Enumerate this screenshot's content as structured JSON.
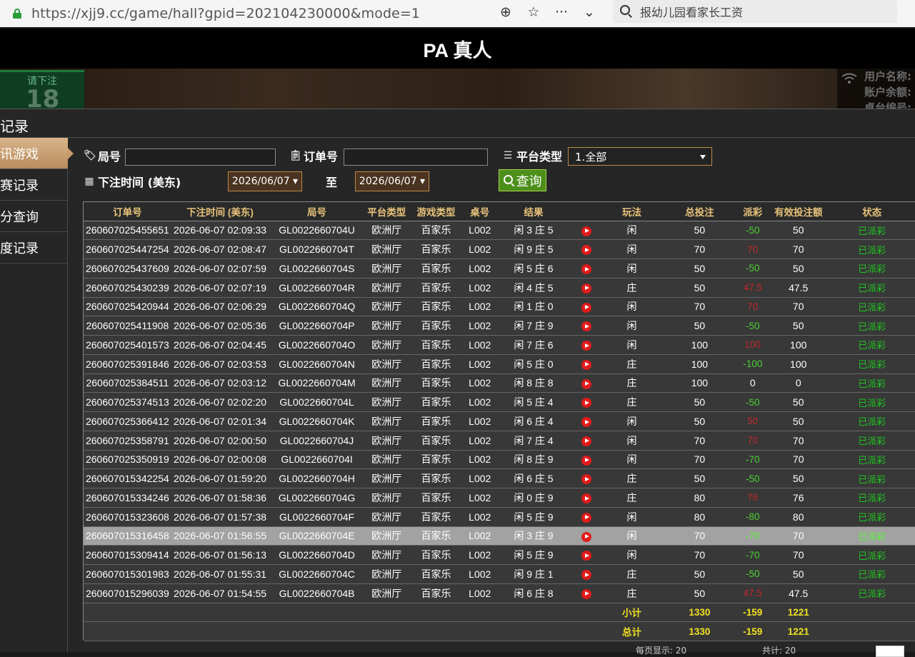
{
  "browser": {
    "url": "https://xjj9.cc/game/hall?gpid=202104230000&mode=1",
    "search_text": "报幼儿园看家长工资",
    "icons": [
      "add-circle-icon",
      "star-icon",
      "more-icon",
      "chevron-down-icon"
    ]
  },
  "header": {
    "title": "PA 真人"
  },
  "scene": {
    "bet_label": "请下注",
    "bet_countdown": "18",
    "user_lines": [
      "用户名称:",
      "账户余额:",
      "桌台编号:"
    ]
  },
  "panel": {
    "title": "记录"
  },
  "sidebar": {
    "items": [
      {
        "label": "讯游戏",
        "active": true
      },
      {
        "label": "赛记录",
        "active": false
      },
      {
        "label": "分查询",
        "active": false
      },
      {
        "label": "度记录",
        "active": false
      }
    ]
  },
  "filters": {
    "round_label": "局号",
    "order_label": "订单号",
    "platform_label": "平台类型",
    "platform_value": "1.全部",
    "time_label": "下注时间 (美东)",
    "date_from": "2026/06/07 ▾",
    "to_label": "至",
    "date_to": "2026/06/07 ▾",
    "query_label": "查询"
  },
  "table": {
    "headers": [
      "订单号",
      "下注时间 (美东)",
      "局号",
      "平台类型",
      "游戏类型",
      "桌号",
      "结果",
      "",
      "玩法",
      "总投注",
      "派彩",
      "有效投注额",
      "状态"
    ],
    "rows": [
      [
        "260607025455651",
        "2026-06-07 02:09:33",
        "GL0022660704U",
        "欧洲厅",
        "百家乐",
        "L002",
        "闲 3 庄 5",
        "闲",
        "50",
        "-50",
        "50",
        "已派彩"
      ],
      [
        "260607025447254",
        "2026-06-07 02:08:47",
        "GL0022660704T",
        "欧洲厅",
        "百家乐",
        "L002",
        "闲 9 庄 5",
        "闲",
        "70",
        "70",
        "70",
        "已派彩"
      ],
      [
        "260607025437609",
        "2026-06-07 02:07:59",
        "GL0022660704S",
        "欧洲厅",
        "百家乐",
        "L002",
        "闲 5 庄 6",
        "闲",
        "50",
        "-50",
        "50",
        "已派彩"
      ],
      [
        "260607025430239",
        "2026-06-07 02:07:19",
        "GL0022660704R",
        "欧洲厅",
        "百家乐",
        "L002",
        "闲 4 庄 5",
        "庄",
        "50",
        "47.5",
        "47.5",
        "已派彩"
      ],
      [
        "260607025420944",
        "2026-06-07 02:06:29",
        "GL0022660704Q",
        "欧洲厅",
        "百家乐",
        "L002",
        "闲 1 庄 0",
        "闲",
        "70",
        "70",
        "70",
        "已派彩"
      ],
      [
        "260607025411908",
        "2026-06-07 02:05:36",
        "GL0022660704P",
        "欧洲厅",
        "百家乐",
        "L002",
        "闲 7 庄 9",
        "闲",
        "50",
        "-50",
        "50",
        "已派彩"
      ],
      [
        "260607025401573",
        "2026-06-07 02:04:45",
        "GL0022660704O",
        "欧洲厅",
        "百家乐",
        "L002",
        "闲 7 庄 6",
        "闲",
        "100",
        "100",
        "100",
        "已派彩"
      ],
      [
        "260607025391846",
        "2026-06-07 02:03:53",
        "GL0022660704N",
        "欧洲厅",
        "百家乐",
        "L002",
        "闲 5 庄 0",
        "庄",
        "100",
        "-100",
        "100",
        "已派彩"
      ],
      [
        "260607025384511",
        "2026-06-07 02:03:12",
        "GL0022660704M",
        "欧洲厅",
        "百家乐",
        "L002",
        "闲 8 庄 8",
        "庄",
        "100",
        "0",
        "0",
        "已派彩"
      ],
      [
        "260607025374513",
        "2026-06-07 02:02:20",
        "GL0022660704L",
        "欧洲厅",
        "百家乐",
        "L002",
        "闲 5 庄 4",
        "庄",
        "50",
        "-50",
        "50",
        "已派彩"
      ],
      [
        "260607025366412",
        "2026-06-07 02:01:34",
        "GL0022660704K",
        "欧洲厅",
        "百家乐",
        "L002",
        "闲 6 庄 4",
        "闲",
        "50",
        "50",
        "50",
        "已派彩"
      ],
      [
        "260607025358791",
        "2026-06-07 02:00:50",
        "GL0022660704J",
        "欧洲厅",
        "百家乐",
        "L002",
        "闲 7 庄 4",
        "闲",
        "70",
        "70",
        "70",
        "已派彩"
      ],
      [
        "260607025350919",
        "2026-06-07 02:00:08",
        "GL0022660704I",
        "欧洲厅",
        "百家乐",
        "L002",
        "闲 8 庄 9",
        "闲",
        "70",
        "-70",
        "70",
        "已派彩"
      ],
      [
        "260607015342254",
        "2026-06-07 01:59:20",
        "GL0022660704H",
        "欧洲厅",
        "百家乐",
        "L002",
        "闲 6 庄 5",
        "庄",
        "50",
        "-50",
        "50",
        "已派彩"
      ],
      [
        "260607015334246",
        "2026-06-07 01:58:36",
        "GL0022660704G",
        "欧洲厅",
        "百家乐",
        "L002",
        "闲 0 庄 9",
        "庄",
        "80",
        "76",
        "76",
        "已派彩"
      ],
      [
        "260607015323608",
        "2026-06-07 01:57:38",
        "GL0022660704F",
        "欧洲厅",
        "百家乐",
        "L002",
        "闲 5 庄 9",
        "闲",
        "80",
        "-80",
        "80",
        "已派彩"
      ],
      [
        "260607015316458",
        "2026-06-07 01:56:55",
        "GL0022660704E",
        "欧洲厅",
        "百家乐",
        "L002",
        "闲 3 庄 9",
        "闲",
        "70",
        "-70",
        "70",
        "已派彩"
      ],
      [
        "260607015309414",
        "2026-06-07 01:56:13",
        "GL0022660704D",
        "欧洲厅",
        "百家乐",
        "L002",
        "闲 5 庄 9",
        "闲",
        "70",
        "-70",
        "70",
        "已派彩"
      ],
      [
        "260607015301983",
        "2026-06-07 01:55:31",
        "GL0022660704C",
        "欧洲厅",
        "百家乐",
        "L002",
        "闲 9 庄 1",
        "庄",
        "50",
        "-50",
        "50",
        "已派彩"
      ],
      [
        "260607015296039",
        "2026-06-07 01:54:55",
        "GL0022660704B",
        "欧洲厅",
        "百家乐",
        "L002",
        "闲 6 庄 8",
        "庄",
        "50",
        "47.5",
        "47.5",
        "已派彩"
      ]
    ],
    "selected_row": 16,
    "subtotal": {
      "label": "小计",
      "total_bet": "1330",
      "payout": "-159",
      "valid_bet": "1221"
    },
    "grand_total": {
      "label": "总计",
      "total_bet": "1330",
      "payout": "-159",
      "valid_bet": "1221"
    }
  },
  "footer": {
    "per_page": "每页显示: 20",
    "total": "共计: 20"
  },
  "colors": {
    "gold": "#e8c27a",
    "green": "#4cd034",
    "red": "#c0282a",
    "yellow": "#f0e020"
  }
}
